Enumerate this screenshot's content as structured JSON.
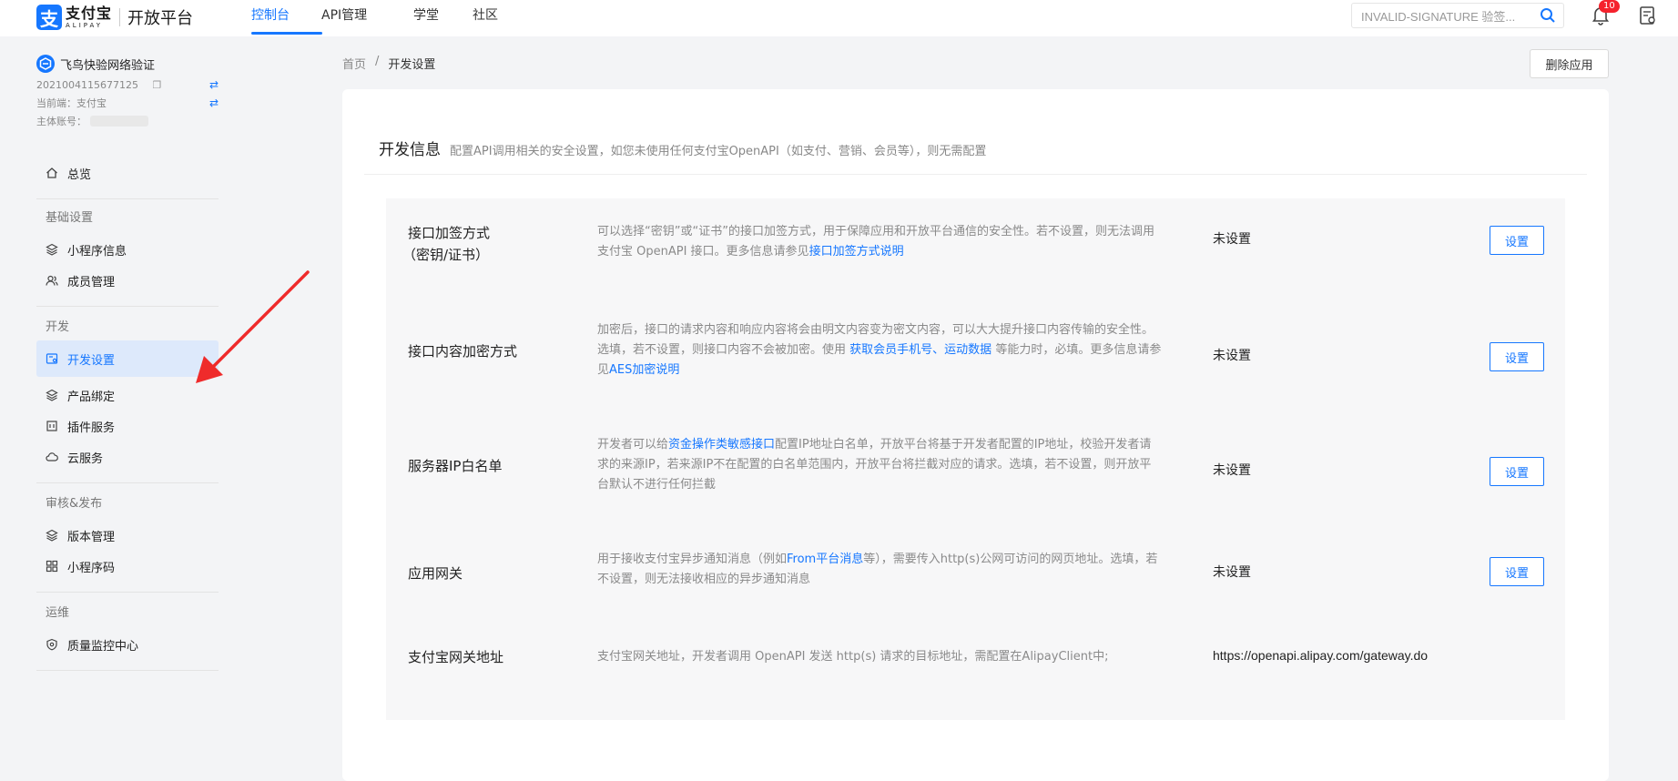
{
  "header": {
    "logo_cn": "支付宝",
    "logo_en": "ALIPAY",
    "platform": "开放平台",
    "nav": [
      {
        "label": "控制台",
        "active": true
      },
      {
        "label": "API管理",
        "active": false
      },
      {
        "label": "学堂",
        "active": false
      },
      {
        "label": "社区",
        "active": false
      }
    ],
    "search_value": "INVALID-SIGNATURE 验签...",
    "notification_count": "10"
  },
  "sidebar": {
    "app_name": "飞鸟快验网络验证",
    "app_id": "2021004115677125",
    "current_end": "当前端：支付宝",
    "owner_label": "主体账号：",
    "groups": {
      "basic": "基础设置",
      "dev": "开发",
      "review": "审核&发布",
      "ops": "运维"
    },
    "items": {
      "overview": "总览",
      "miniapp_info": "小程序信息",
      "members": "成员管理",
      "dev_settings": "开发设置",
      "product_bind": "产品绑定",
      "plugins": "插件服务",
      "cloud": "云服务",
      "versions": "版本管理",
      "qrcode": "小程序码",
      "quality": "质量监控中心"
    }
  },
  "breadcrumb": {
    "home": "首页",
    "separator": "/",
    "current": "开发设置"
  },
  "delete_button": "删除应用",
  "dev_info": {
    "title": "开发信息",
    "subtitle": "配置API调用相关的安全设置，如您未使用任何支付宝OpenAPI（如支付、营销、会员等），则无需配置",
    "rows": [
      {
        "label_line1": "接口加签方式",
        "label_line2": "（密钥/证书）",
        "desc_a": "可以选择“密钥”或“证书”的接口加签方式，用于保障应用和开放平台通信的安全性。若不设置，则无法调用支付宝 OpenAPI 接口。更多信息请参见",
        "desc_link": "接口加签方式说明",
        "value": "未设置",
        "button": "设置"
      },
      {
        "label": "接口内容加密方式",
        "desc_a": "加密后，接口的请求内容和响应内容将会由明文内容变为密文内容，可以大大提升接口内容传输的安全性。选填，若不设置，则接口内容不会被加密。使用 ",
        "desc_link1": "获取会员手机号",
        "desc_sep": "、",
        "desc_link2": "运动数据",
        "desc_b": " 等能力时，必填。更多信息请参见",
        "desc_link3": "AES加密说明",
        "value": "未设置",
        "button": "设置"
      },
      {
        "label": "服务器IP白名单",
        "desc_a": "开发者可以给",
        "desc_link": "资金操作类敏感接口",
        "desc_b": "配置IP地址白名单，开放平台将基于开发者配置的IP地址，校验开发者请求的来源IP，若来源IP不在配置的白名单范围内，开放平台将拦截对应的请求。选填，若不设置，则开放平台默认不进行任何拦截",
        "value": "未设置",
        "button": "设置"
      },
      {
        "label": "应用网关",
        "desc_a": "用于接收支付宝异步通知消息（例如",
        "desc_link": "From平台消息",
        "desc_b": "等），需要传入http(s)公网可访问的网页地址。选填，若不设置，则无法接收相应的异步通知消息",
        "value": "未设置",
        "button": "设置"
      },
      {
        "label": "支付宝网关地址",
        "desc_a": "支付宝网关地址，开发者调用 OpenAPI 发送 http(s) 请求的目标地址，需配置在AlipayClient中;",
        "value": "https://openapi.alipay.com/gateway.do"
      }
    ]
  },
  "colors": {
    "primary": "#1677ff",
    "arrow": "#ef2b2b"
  }
}
